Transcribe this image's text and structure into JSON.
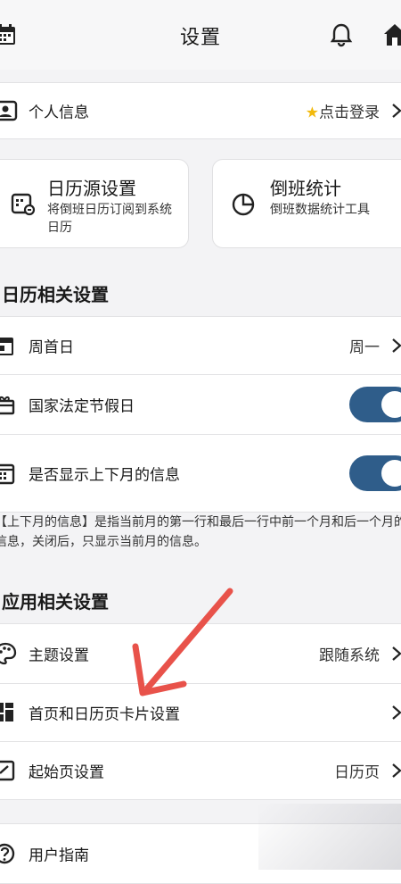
{
  "header": {
    "title": "设置",
    "icons": [
      "calendar-icon",
      "bell-icon",
      "home-icon"
    ]
  },
  "profile": {
    "label": "个人信息",
    "value": "点击登录",
    "icon": "id-card-icon",
    "value_icon": "star-icon"
  },
  "cards": [
    {
      "title": "日历源设置",
      "desc": "将倒班日历订阅到系统日历",
      "icon": "calendar-source-icon"
    },
    {
      "title": "倒班统计",
      "desc": "倒班数据统计工具",
      "icon": "pie-chart-icon"
    }
  ],
  "calendar_section": {
    "title": "日历相关设置",
    "items": [
      {
        "label": "周首日",
        "value": "周一",
        "icon": "calendar-week-icon"
      },
      {
        "label": "国家法定节假日",
        "toggle": true,
        "icon": "gift-icon"
      },
      {
        "label": "是否显示上下月的信息",
        "toggle": true,
        "icon": "calendar-grid-icon"
      }
    ],
    "note": "【上下月的信息】是指当前月的第一行和最后一行中前一个月和后一个月的信息，关闭后，只显示当前月的信息。"
  },
  "app_section": {
    "title": "应用相关设置",
    "items": [
      {
        "label": "主题设置",
        "value": "跟随系统",
        "icon": "palette-icon"
      },
      {
        "label": "首页和日历页卡片设置",
        "value": "",
        "icon": "grid-icon"
      },
      {
        "label": "起始页设置",
        "value": "日历页",
        "icon": "start-page-icon"
      },
      {
        "label": "用户指南",
        "value": "",
        "icon": "help-icon"
      }
    ]
  },
  "colors": {
    "accent": "#2f5d8a",
    "annotation_arrow": "#e8524a",
    "background": "#f3f3f5"
  }
}
